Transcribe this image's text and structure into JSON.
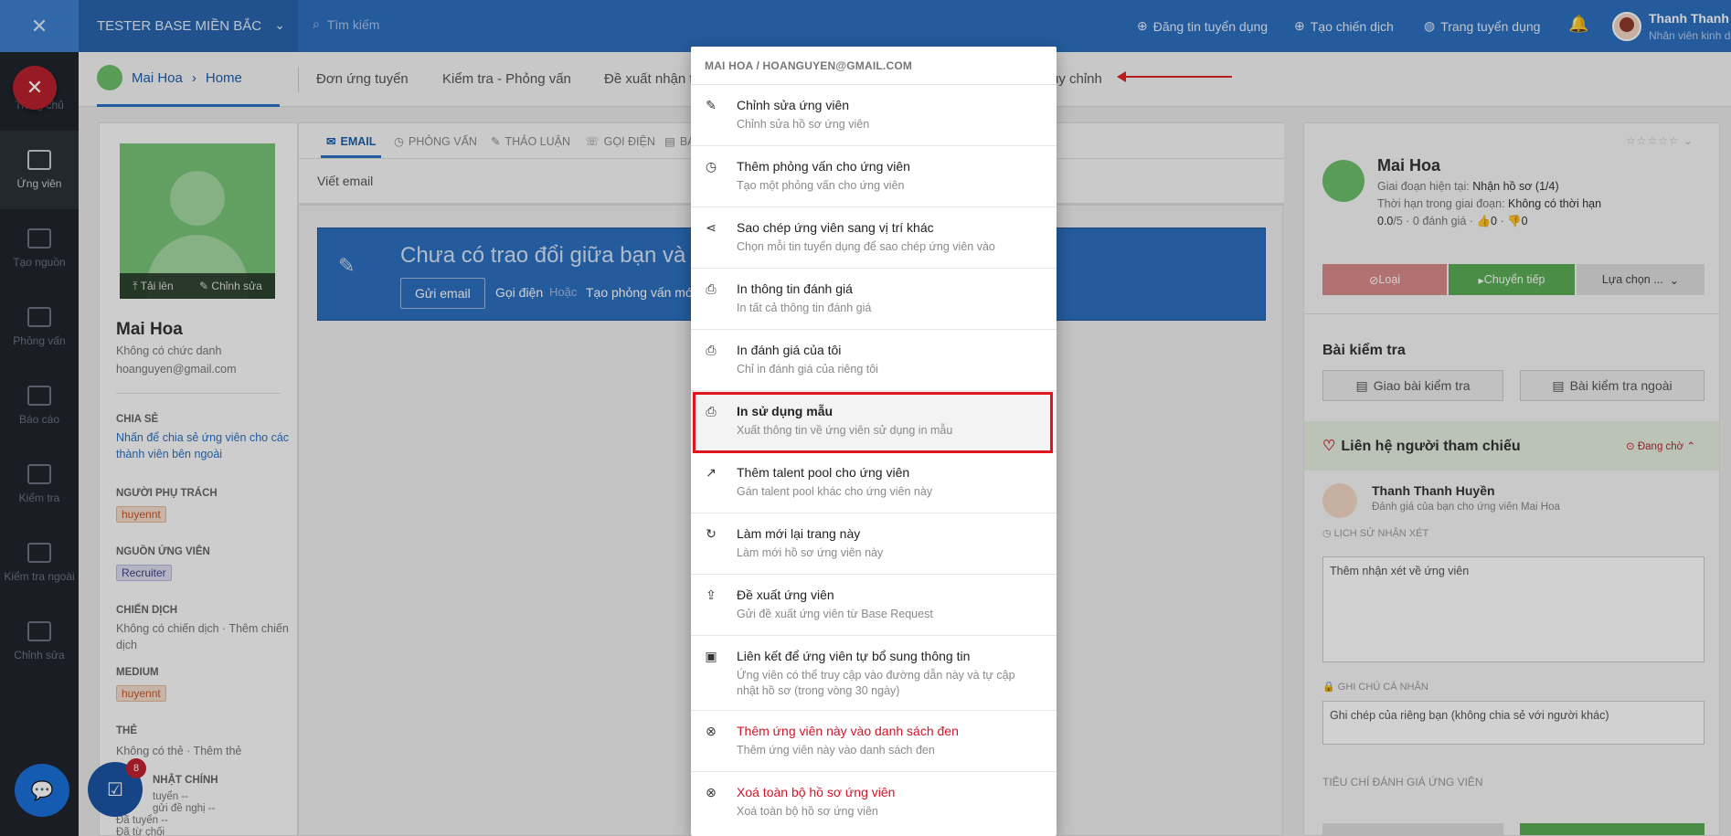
{
  "topbar": {
    "company": "TESTER BASE MIỀN BẮC",
    "search_placeholder": "Tìm kiếm",
    "link_post": "Đăng tin tuyển dụng",
    "link_campaign": "Tạo chiến dịch",
    "link_careers": "Trang tuyển dụng",
    "user_name": "Thanh Thanh ...",
    "user_role": "Nhân viên kinh d..."
  },
  "sidebar": {
    "items": [
      "Trang chủ",
      "Ứng viên",
      "Tạo nguồn",
      "Phỏng vấn",
      "Báo cáo",
      "Kiểm tra",
      "Kiểm tra ngoài",
      "Chỉnh sửa"
    ]
  },
  "chat": {
    "task_badge": "8"
  },
  "subnav": {
    "crumb_name": "Mai Hoa",
    "crumb_sep": "›",
    "crumb_page": "Home",
    "tabs": [
      "Đơn ứng tuyển",
      "Kiểm tra - Phỏng vấn",
      "Đề xuất nhận t",
      "ùy chỉnh"
    ]
  },
  "profile": {
    "upload": "Tải lên",
    "edit": "Chỉnh sửa",
    "name": "Mai Hoa",
    "title": "Không có chức danh",
    "email": "hoanguyen@gmail.com",
    "share_label": "CHIA SẺ",
    "share_text": "Nhấn để chia sẻ ứng viên cho các thành viên bên ngoài",
    "owner_label": "NGƯỜI PHỤ TRÁCH",
    "owner": "huyennt",
    "source_label": "NGUỒN ỨNG VIÊN",
    "source": "Recruiter",
    "campaign_label": "CHIẾN DỊCH",
    "campaign_text": "Không có chiến dịch · Thêm chiến dịch",
    "medium_label": "MEDIUM",
    "medium": "huyennt",
    "tags_label": "THẺ",
    "tags_text": "Không có thẻ · Thêm thẻ",
    "updates_label": "NHẬT CHÍNH",
    "update_lines": [
      "tuyển --",
      "gửi đề nghị --",
      "Đã tuyển --",
      "Đã từ chối"
    ]
  },
  "center": {
    "tabs": [
      "EMAIL",
      "PHỎNG VẤN",
      "THẢO LUẬN",
      "GỌI ĐIỆN",
      "BA"
    ],
    "compose": "Viết email",
    "banner_msg": "Chưa có trao đổi giữa bạn và ứ",
    "send_email": "Gửi email",
    "call": "Gọi điện",
    "or": "Hoặc",
    "create_interview": "Tạo phỏng vấn mớ"
  },
  "right": {
    "name": "Mai Hoa",
    "stage_label": "Giai đoạn hiện tại:",
    "stage_value": "Nhận hồ sơ (1/4)",
    "time_label": "Thời hạn trong giai đoạn:",
    "time_value": "Không có thời hạn",
    "rating": "0.0",
    "rating_suffix": "/5 · 0 đánh giá ·",
    "likes": "0",
    "dislikes": "0",
    "reject": "Loại",
    "forward": "Chuyển tiếp",
    "choose": "Lựa chọn ...",
    "tests_title": "Bài kiểm tra",
    "assign_test": "Giao bài kiểm tra",
    "external_test": "Bài kiểm tra ngoài",
    "ref_title": "Liên hệ người tham chiếu",
    "ref_status": "Đang chờ",
    "reviewer_name": "Thanh Thanh Huyền",
    "reviewer_sub": "Đánh giá của bạn cho ứng viên Mai Hoa",
    "history_label": "LỊCH SỬ NHẬN XÉT",
    "comment_placeholder": "Thêm nhận xét về ứng viên",
    "private_label": "GHI CHÚ CÁ NHÂN",
    "private_placeholder": "Ghi chép của riêng bạn (không chia sẻ với người khác)",
    "criteria_label": "TIÊU CHÍ ĐÁNH GIÁ ỨNG VIÊN"
  },
  "menu": {
    "header": "MAI HOA / HOANGUYEN@GMAIL.COM",
    "items": [
      {
        "icon": "pencil-icon",
        "title": "Chỉnh sửa ứng viên",
        "desc": "Chỉnh sửa hồ sơ ứng viên"
      },
      {
        "icon": "clock-icon",
        "title": "Thêm phỏng vấn cho ứng viên",
        "desc": "Tạo một phỏng vấn cho ứng viên"
      },
      {
        "icon": "share-icon",
        "title": "Sao chép ứng viên sang vị trí khác",
        "desc": "Chọn mỗi tin tuyển dụng để sao chép ứng viên vào"
      },
      {
        "icon": "print-icon",
        "title": "In thông tin đánh giá",
        "desc": "In tất cả thông tin đánh giá"
      },
      {
        "icon": "print-icon",
        "title": "In đánh giá của tôi",
        "desc": "Chỉ in đánh giá của riêng tôi"
      },
      {
        "icon": "print-icon",
        "title": "In sử dụng mẫu",
        "desc": "Xuất thông tin về ứng viên sử dụng in mẫu"
      },
      {
        "icon": "trend-icon",
        "title": "Thêm talent pool cho ứng viên",
        "desc": "Gán talent pool khác cho ứng viên này"
      },
      {
        "icon": "refresh-icon",
        "title": "Làm mới lại trang này",
        "desc": "Làm mới hồ sơ ứng viên này"
      },
      {
        "icon": "export-icon",
        "title": "Đề xuất ứng viên",
        "desc": "Gửi đề xuất ứng viên từ Base Request"
      },
      {
        "icon": "file-icon",
        "title": "Liên kết để ứng viên tự bổ sung thông tin",
        "desc": "Ứng viên có thể truy cập vào đường dẫn này và tự cập nhật hồ sơ (trong vòng 30 ngày)"
      },
      {
        "icon": "ban-icon",
        "title": "Thêm ứng viên này vào danh sách đen",
        "desc": "Thêm ứng viên này vào danh sách đen"
      },
      {
        "icon": "ban-icon",
        "title": "Xoá toàn bộ hồ sơ ứng viên",
        "desc": "Xoá toàn bộ hồ sơ ứng viên"
      }
    ]
  },
  "colors": {
    "brand": "#2d6fc0",
    "danger": "#d0152a",
    "highlight_border": "#e0151e",
    "success": "#5cab57"
  }
}
